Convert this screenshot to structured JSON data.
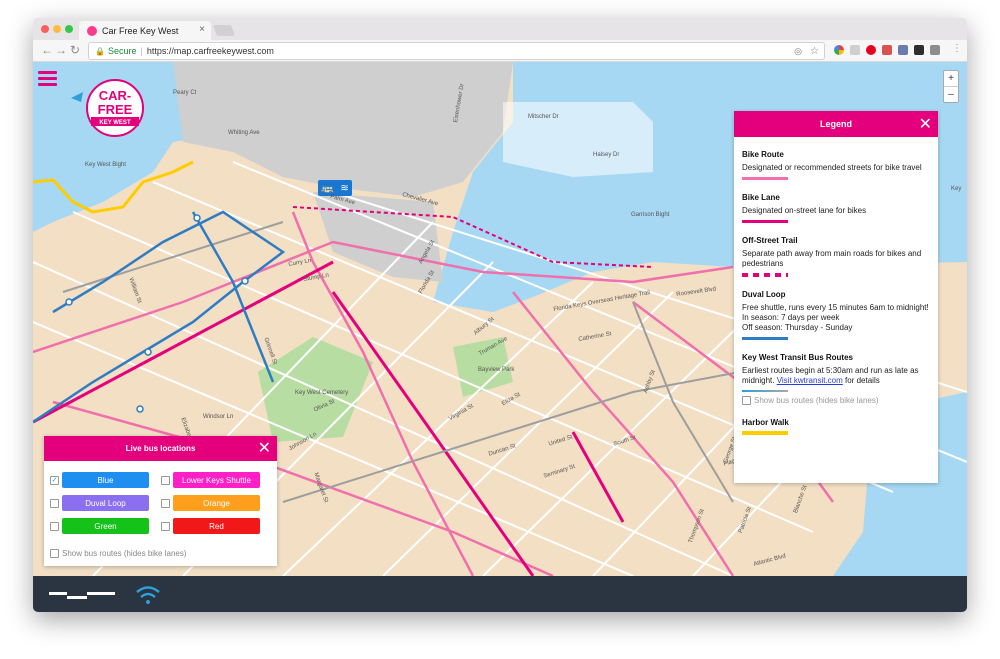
{
  "browser": {
    "tab_title": "Car Free Key West",
    "secure_label": "Secure",
    "url": "https://map.carfreekeywest.com"
  },
  "map": {
    "zoom_in": "+",
    "zoom_out": "–",
    "logo": {
      "line1": "CAR-",
      "line2": "FREE",
      "line3": "KEY WEST"
    },
    "labels": [
      {
        "text": "Peary Ct"
      },
      {
        "text": "Whiting Ave"
      },
      {
        "text": "Key West Bight"
      },
      {
        "text": "Mitscher Dr"
      },
      {
        "text": "Halsey Dr"
      },
      {
        "text": "Eisenhower Dr"
      },
      {
        "text": "Chevalier Ave"
      },
      {
        "text": "Garrison Bight"
      },
      {
        "text": "Palm Ave"
      },
      {
        "text": "Roosevelt Blvd"
      },
      {
        "text": "Catherine St"
      },
      {
        "text": "Truman Ave"
      },
      {
        "text": "United St"
      },
      {
        "text": "Duncan St"
      },
      {
        "text": "Seminary St"
      },
      {
        "text": "South St"
      },
      {
        "text": "Flagler Ave"
      },
      {
        "text": "Johnson Ln"
      },
      {
        "text": "Windsor Ln"
      },
      {
        "text": "Olivia St"
      },
      {
        "text": "Angela St"
      },
      {
        "text": "Florida St"
      },
      {
        "text": "Albury St"
      },
      {
        "text": "Grinnell St"
      },
      {
        "text": "Virginia St"
      },
      {
        "text": "Eliza St"
      },
      {
        "text": "Bayview Park"
      },
      {
        "text": "Key West Cemetery"
      },
      {
        "text": "Margaret St"
      },
      {
        "text": "Elizabeth St"
      },
      {
        "text": "William St"
      },
      {
        "text": "Curry Ln"
      },
      {
        "text": "Stump Ln"
      },
      {
        "text": "Florida Keys Overseas Heritage Trail"
      },
      {
        "text": "Atlantic Blvd"
      },
      {
        "text": "George St"
      },
      {
        "text": "Blanche St"
      },
      {
        "text": "Patricia St"
      },
      {
        "text": "Thompson St"
      },
      {
        "text": "Ashby St"
      },
      {
        "text": "Key"
      }
    ]
  },
  "legend": {
    "title": "Legend",
    "close": "✕",
    "items": [
      {
        "title": "Bike Route",
        "desc": "Designated or recommended streets for bike travel",
        "color": "#f06fac"
      },
      {
        "title": "Bike Lane",
        "desc": "Designated on-street lane for bikes",
        "color": "#e4007c"
      },
      {
        "title": "Off-Street Trail",
        "desc": "Separate path away from main roads for bikes and pedestrians",
        "color": "#e4007c"
      },
      {
        "title": "Duval Loop",
        "desc1": "Free shuttle, runs every 15 minutes 6am to midnight!",
        "desc2": "In season: 7 days per week",
        "desc3": "Off season: Thursday - Sunday",
        "color": "#2e7cc4"
      },
      {
        "title": "Key West Transit Bus Routes",
        "desc": "Earliest routes begin at 5:30am and run as late as midnight.",
        "link": "Visit kwtransit.com",
        "desc_end": "for details",
        "color": "#aaaaaa"
      },
      {
        "title": "Harbor Walk",
        "color": "#ffcc00"
      }
    ],
    "show_bus_routes": "Show bus routes (hides bike lanes)"
  },
  "bus_panel": {
    "title": "Live bus locations",
    "close": "✕",
    "buttons": [
      {
        "label": "Blue",
        "color": "#1f8ef1",
        "checked": true
      },
      {
        "label": "Lower Keys Shuttle",
        "color": "#ff1fc6",
        "checked": false
      },
      {
        "label": "Duval Loop",
        "color": "#8a6ff0",
        "checked": false
      },
      {
        "label": "Orange",
        "color": "#ff9f1c",
        "checked": false
      },
      {
        "label": "Green",
        "color": "#14c21a",
        "checked": false
      },
      {
        "label": "Red",
        "color": "#f01818",
        "checked": false
      }
    ],
    "show_bus_routes": "Show bus routes (hides bike lanes)"
  },
  "colors": {
    "accent": "#e4007c",
    "water": "#a6d8f3",
    "land": "#f2dfc4",
    "footer": "#2b3441"
  }
}
